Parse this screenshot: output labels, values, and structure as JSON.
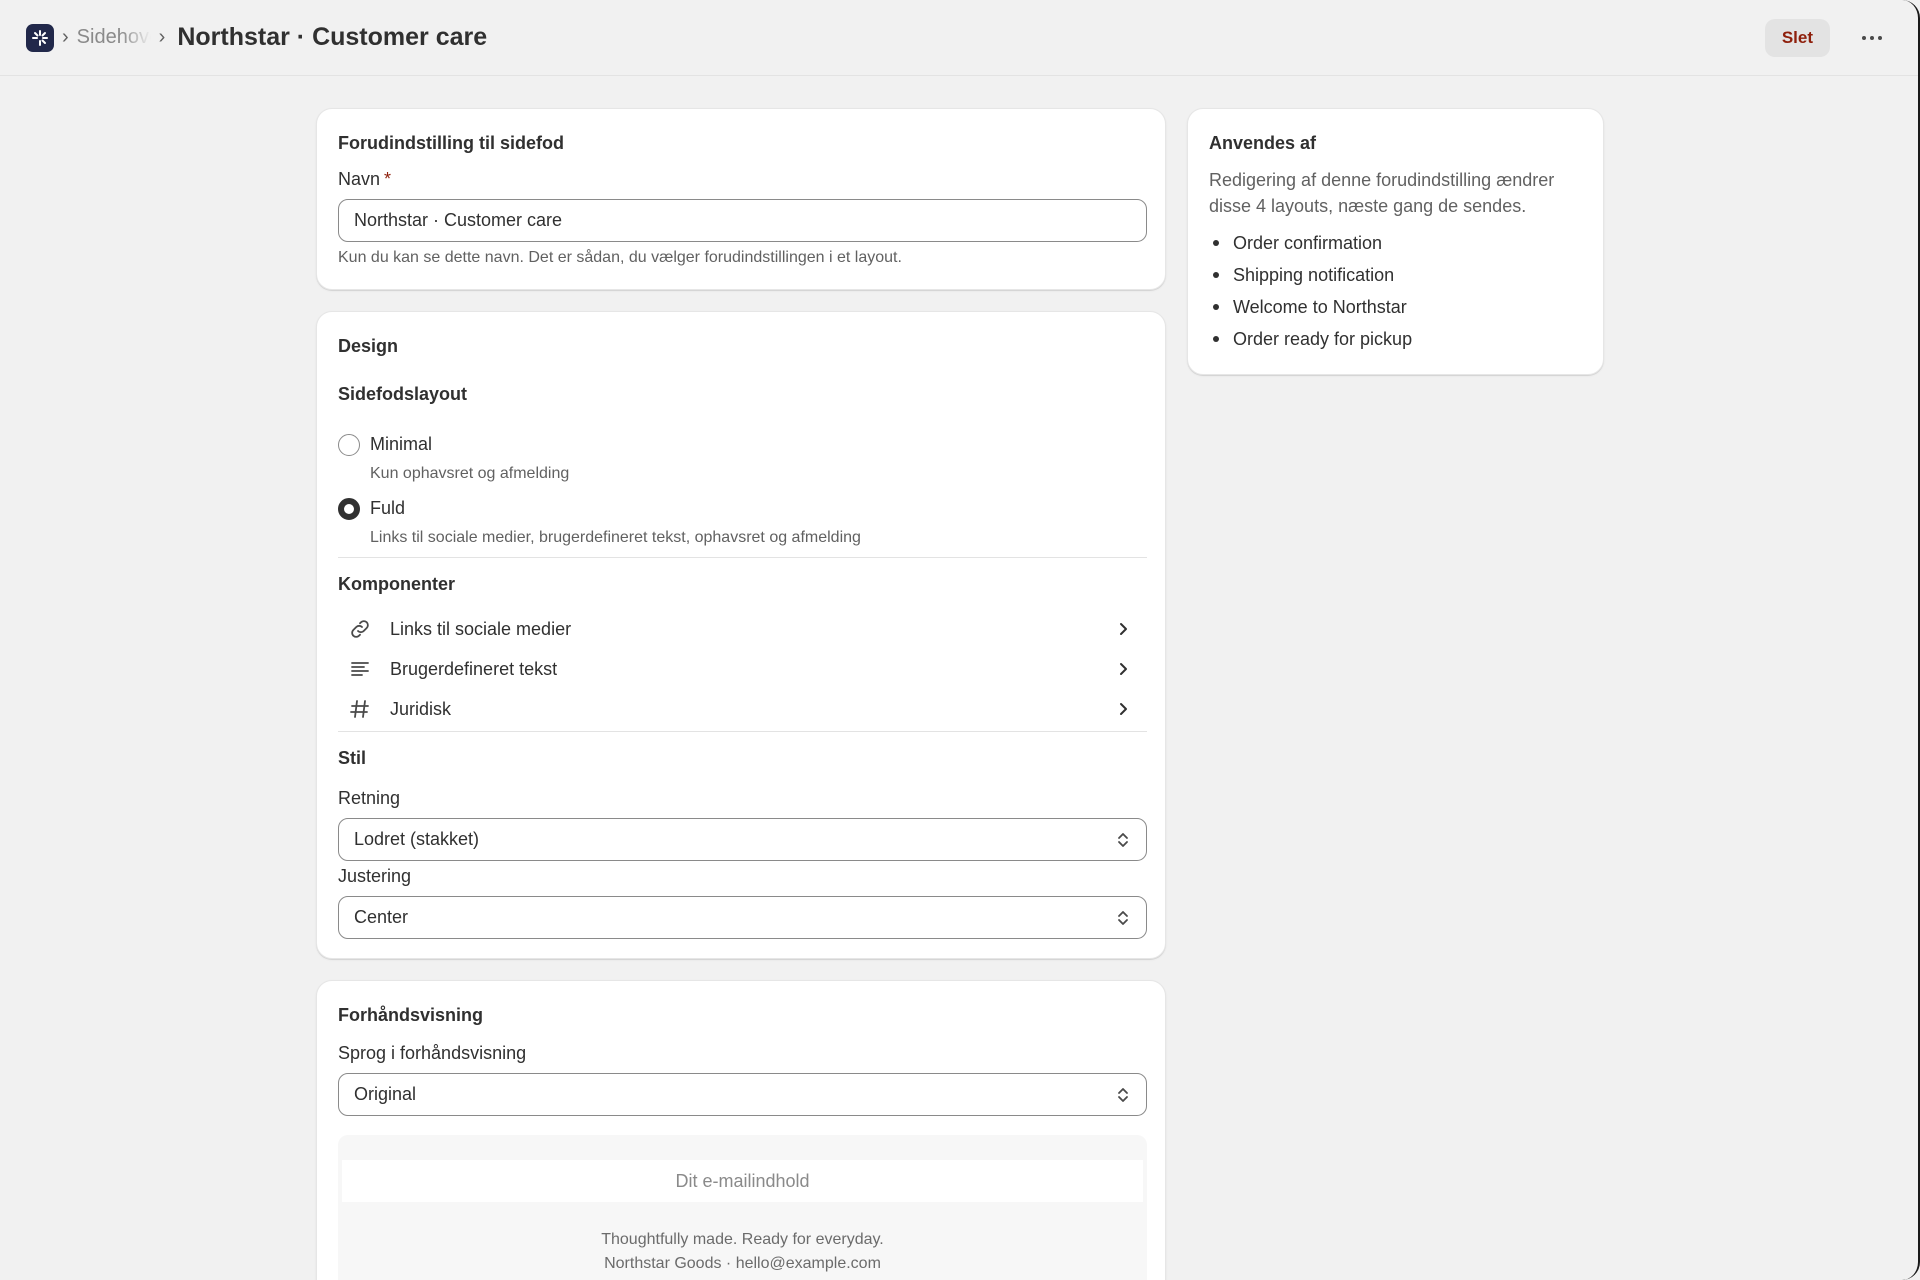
{
  "header": {
    "breadcrumb_parent": "Sidehoved",
    "page_title": "Northstar · Customer care",
    "delete_label": "Slet"
  },
  "preset_card": {
    "title": "Forudindstilling til sidefod",
    "name_label": "Navn",
    "required_mark": "*",
    "name_value": "Northstar · Customer care",
    "name_help": "Kun du kan se dette navn. Det er sådan, du vælger forudindstillingen i et layout."
  },
  "design_card": {
    "title": "Design",
    "layout_heading": "Sidefodslayout",
    "layout_options": [
      {
        "label": "Minimal",
        "description": "Kun ophavsret og afmelding",
        "selected": false
      },
      {
        "label": "Fuld",
        "description": "Links til sociale medier, brugerdefineret tekst, ophavsret og afmelding",
        "selected": true
      }
    ],
    "components_heading": "Komponenter",
    "components": [
      {
        "label": "Links til sociale medier",
        "icon": "link-icon"
      },
      {
        "label": "Brugerdefineret tekst",
        "icon": "text-align-icon"
      },
      {
        "label": "Juridisk",
        "icon": "hash-icon"
      }
    ],
    "style_heading": "Stil",
    "direction_label": "Retning",
    "direction_value": "Lodret (stakket)",
    "alignment_label": "Justering",
    "alignment_value": "Center"
  },
  "preview_card": {
    "title": "Forhåndsvisning",
    "language_label": "Sprog i forhåndsvisning",
    "language_value": "Original",
    "email_placeholder": "Dit e-mailindhold",
    "footer_line_1": "Thoughtfully made. Ready for everyday.",
    "footer_line_2": "Northstar Goods · hello@example.com"
  },
  "used_by_card": {
    "title": "Anvendes af",
    "description": "Redigering af denne forudindstilling ændrer disse 4 layouts, næste gang de sendes.",
    "layouts": [
      "Order confirmation",
      "Shipping notification",
      "Welcome to Northstar",
      "Order ready for pickup"
    ]
  },
  "colors": {
    "brand": "#21284a",
    "danger_text": "#8e1f0b",
    "page_bg": "#f1f1f1"
  }
}
